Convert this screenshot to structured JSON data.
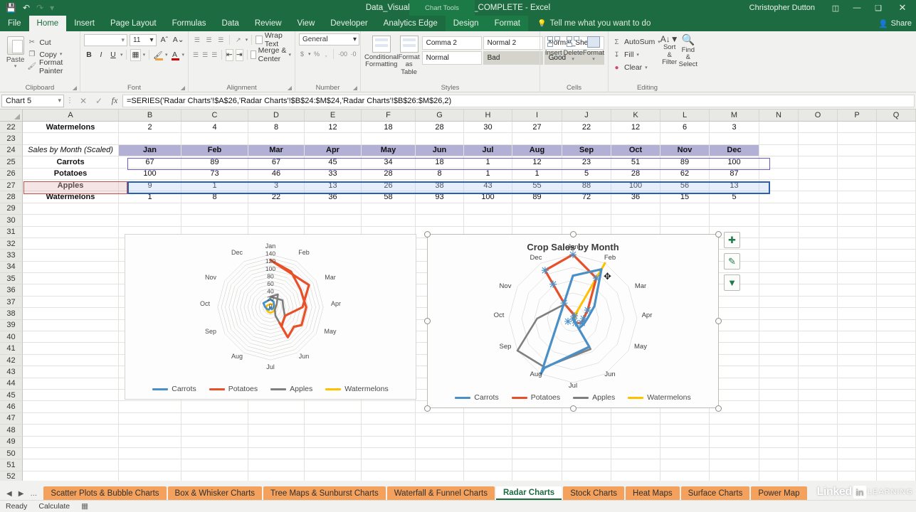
{
  "titlebar": {
    "save_icon": "save-icon",
    "undo_icon": "undo-icon",
    "redo_icon": "redo-icon",
    "customize_icon": "customize-qat-icon",
    "title": "Data_Visualization_Exercises_COMPLETE - Excel",
    "chart_tools": "Chart Tools",
    "user": "Christopher Dutton",
    "ribbon_display_icon": "ribbon-display-options-icon",
    "minimize": "—",
    "restore": "❑",
    "close": "✕"
  },
  "ribbon_tabs": [
    {
      "label": "File",
      "active": false
    },
    {
      "label": "Home",
      "active": true
    },
    {
      "label": "Insert",
      "active": false
    },
    {
      "label": "Page Layout",
      "active": false
    },
    {
      "label": "Formulas",
      "active": false
    },
    {
      "label": "Data",
      "active": false
    },
    {
      "label": "Review",
      "active": false
    },
    {
      "label": "View",
      "active": false
    },
    {
      "label": "Developer",
      "active": false
    },
    {
      "label": "Analytics Edge",
      "active": false
    },
    {
      "label": "Design",
      "active": false,
      "contextual": true
    },
    {
      "label": "Format",
      "active": false,
      "contextual": true
    }
  ],
  "tellme": "Tell me what you want to do",
  "share": "Share",
  "ribbon": {
    "clipboard": {
      "group_label": "Clipboard",
      "paste": "Paste",
      "cut": "Cut",
      "copy": "Copy",
      "format_painter": "Format Painter"
    },
    "font": {
      "group_label": "Font",
      "font_name": "",
      "font_size": "11",
      "grow_font": "A",
      "shrink_font": "A",
      "bold": "B",
      "italic": "I",
      "underline": "U",
      "borders": "▦",
      "fill_color": "A",
      "font_color": "A"
    },
    "alignment": {
      "group_label": "Alignment",
      "wrap_text": "Wrap Text",
      "merge_center": "Merge & Center"
    },
    "number": {
      "group_label": "Number",
      "format": "General",
      "currency": "$",
      "percent": "%",
      "comma": ",",
      "increase_decimal": "·00",
      "decrease_decimal": "·0"
    },
    "styles": {
      "group_label": "Styles",
      "conditional_formatting": "Conditional Formatting",
      "format_as_table": "Format as Table",
      "gallery": [
        {
          "label": "Comma 2",
          "variant": "plain"
        },
        {
          "label": "Normal 2",
          "variant": "plain"
        },
        {
          "label": "Normal_Sheet1",
          "variant": "plain"
        },
        {
          "label": "Normal",
          "variant": "plain"
        },
        {
          "label": "Bad",
          "variant": "grey"
        },
        {
          "label": "Good",
          "variant": "grey"
        }
      ]
    },
    "cells": {
      "group_label": "Cells",
      "insert": "Insert",
      "delete": "Delete",
      "format": "Format"
    },
    "editing": {
      "group_label": "Editing",
      "autosum": "AutoSum",
      "fill": "Fill",
      "clear": "Clear",
      "sort_filter": "Sort & Filter",
      "find_select": "Find & Select"
    }
  },
  "formula_bar": {
    "name_box": "Chart 5",
    "cancel_icon": "cancel-icon",
    "enter_icon": "confirm-icon",
    "fx_icon": "insert-function-icon",
    "formula": "=SERIES('Radar Charts'!$A$26,'Radar Charts'!$B$24:$M$24,'Radar Charts'!$B$26:$M$26,2)"
  },
  "grid": {
    "columns": [
      "A",
      "B",
      "C",
      "D",
      "E",
      "F",
      "G",
      "H",
      "I",
      "J",
      "K",
      "L",
      "M",
      "N",
      "O",
      "P",
      "Q"
    ],
    "rows": [
      22,
      23,
      24,
      25,
      26,
      27,
      28,
      29,
      30,
      31,
      32,
      33,
      34,
      35,
      36,
      37,
      38,
      39,
      40,
      41,
      42,
      43,
      44,
      45,
      46,
      47,
      48,
      49,
      50,
      51,
      52
    ],
    "data": {
      "22": {
        "A": "Watermelons",
        "vals": [
          "2",
          "4",
          "8",
          "12",
          "18",
          "28",
          "30",
          "27",
          "22",
          "12",
          "6",
          "3"
        ]
      },
      "23": {
        "A": "",
        "vals": [
          "",
          "",
          "",
          "",
          "",
          "",
          "",
          "",
          "",
          "",
          "",
          ""
        ]
      },
      "24": {
        "A": "Sales by Month (Scaled)",
        "vals": [
          "Jan",
          "Feb",
          "Mar",
          "Apr",
          "May",
          "Jun",
          "Jul",
          "Aug",
          "Sep",
          "Oct",
          "Nov",
          "Dec"
        ]
      },
      "25": {
        "A": "Carrots",
        "vals": [
          "67",
          "89",
          "67",
          "45",
          "34",
          "18",
          "1",
          "12",
          "23",
          "51",
          "89",
          "100"
        ]
      },
      "26": {
        "A": "Potatoes",
        "vals": [
          "100",
          "73",
          "46",
          "33",
          "28",
          "8",
          "1",
          "1",
          "5",
          "28",
          "62",
          "87"
        ]
      },
      "27": {
        "A": "Apples",
        "vals": [
          "9",
          "1",
          "3",
          "13",
          "26",
          "38",
          "43",
          "55",
          "88",
          "100",
          "56",
          "13"
        ]
      },
      "28": {
        "A": "Watermelons",
        "vals": [
          "1",
          "8",
          "22",
          "36",
          "58",
          "93",
          "100",
          "89",
          "72",
          "36",
          "15",
          "5"
        ]
      }
    }
  },
  "chart_data": [
    {
      "id": "left-radar-chart",
      "type": "radar",
      "title": "",
      "categories": [
        "Jan",
        "Feb",
        "Mar",
        "Apr",
        "May",
        "Jun",
        "Jul",
        "Aug",
        "Sep",
        "Oct",
        "Nov",
        "Dec"
      ],
      "radial_ticks": [
        "0",
        "20",
        "40",
        "60",
        "80",
        "100",
        "120",
        "140"
      ],
      "rlim": [
        0,
        140
      ],
      "grid": true,
      "legend_position": "bottom",
      "series": [
        {
          "name": "Carrots",
          "color": "#4a90c7",
          "values": [
            21,
            17,
            12,
            8,
            6,
            3,
            0,
            2,
            4,
            9,
            16,
            19
          ]
        },
        {
          "name": "Potatoes",
          "color": "#e8502a",
          "values": [
            125,
            112,
            92,
            76,
            66,
            52,
            46,
            48,
            58,
            78,
            102,
            118
          ]
        },
        {
          "name": "Apples",
          "color": "#7f7f7f",
          "values": [
            28,
            24,
            18,
            14,
            12,
            14,
            18,
            22,
            30,
            38,
            36,
            32
          ]
        },
        {
          "name": "Watermelons",
          "color": "#ffc000",
          "values": [
            8,
            9,
            11,
            12,
            13,
            14,
            15,
            14,
            13,
            11,
            9,
            8
          ]
        }
      ]
    },
    {
      "id": "right-radar-chart",
      "type": "radar",
      "title": "Crop Sales by Month",
      "categories": [
        "Jan",
        "Feb",
        "Mar",
        "Apr",
        "May",
        "Jun",
        "Jul",
        "Aug",
        "Sep",
        "Oct",
        "Nov",
        "Dec"
      ],
      "rlim": [
        0,
        100
      ],
      "grid": true,
      "legend_position": "bottom",
      "selected_series": "Potatoes",
      "series": [
        {
          "name": "Carrots",
          "color": "#4a90c7",
          "values": [
            67,
            89,
            67,
            45,
            34,
            18,
            1,
            12,
            23,
            51,
            89,
            100
          ]
        },
        {
          "name": "Potatoes",
          "color": "#e8502a",
          "values": [
            100,
            73,
            46,
            33,
            28,
            8,
            1,
            1,
            5,
            28,
            62,
            87
          ]
        },
        {
          "name": "Apples",
          "color": "#7f7f7f",
          "values": [
            9,
            1,
            3,
            13,
            26,
            38,
            43,
            55,
            88,
            100,
            56,
            13
          ]
        },
        {
          "name": "Watermelons",
          "color": "#ffc000",
          "values": [
            1,
            8,
            22,
            36,
            58,
            93,
            100,
            89,
            72,
            36,
            15,
            5
          ]
        }
      ]
    }
  ],
  "chart_buttons": [
    {
      "name": "chart-elements-button",
      "glyph": "✚"
    },
    {
      "name": "chart-styles-button",
      "glyph": "✎"
    },
    {
      "name": "chart-filters-button",
      "glyph": "▼"
    }
  ],
  "sheet_tabs": [
    {
      "label": "Scatter Plots & Bubble Charts",
      "active": false
    },
    {
      "label": "Box & Whisker Charts",
      "active": false
    },
    {
      "label": "Tree Maps & Sunburst Charts",
      "active": false
    },
    {
      "label": "Waterfall & Funnel Charts",
      "active": false
    },
    {
      "label": "Radar Charts",
      "active": true
    },
    {
      "label": "Stock Charts",
      "active": false
    },
    {
      "label": "Heat Maps",
      "active": false
    },
    {
      "label": "Surface Charts",
      "active": false
    },
    {
      "label": "Power Map",
      "active": false
    }
  ],
  "sheet_nav": {
    "first": "◀",
    "next": "▶",
    "more": "…"
  },
  "status_bar": {
    "ready": "Ready",
    "calculate": "Calculate"
  },
  "watermark": {
    "linked": "Linked",
    "in": "in",
    "learning": "LEARNING"
  },
  "colors": {
    "excel_green": "#1d6b41",
    "carrots": "#4a90c7",
    "potatoes": "#e8502a",
    "apples": "#7f7f7f",
    "watermelons": "#ffc000",
    "tab_orange": "#f4a15d"
  }
}
